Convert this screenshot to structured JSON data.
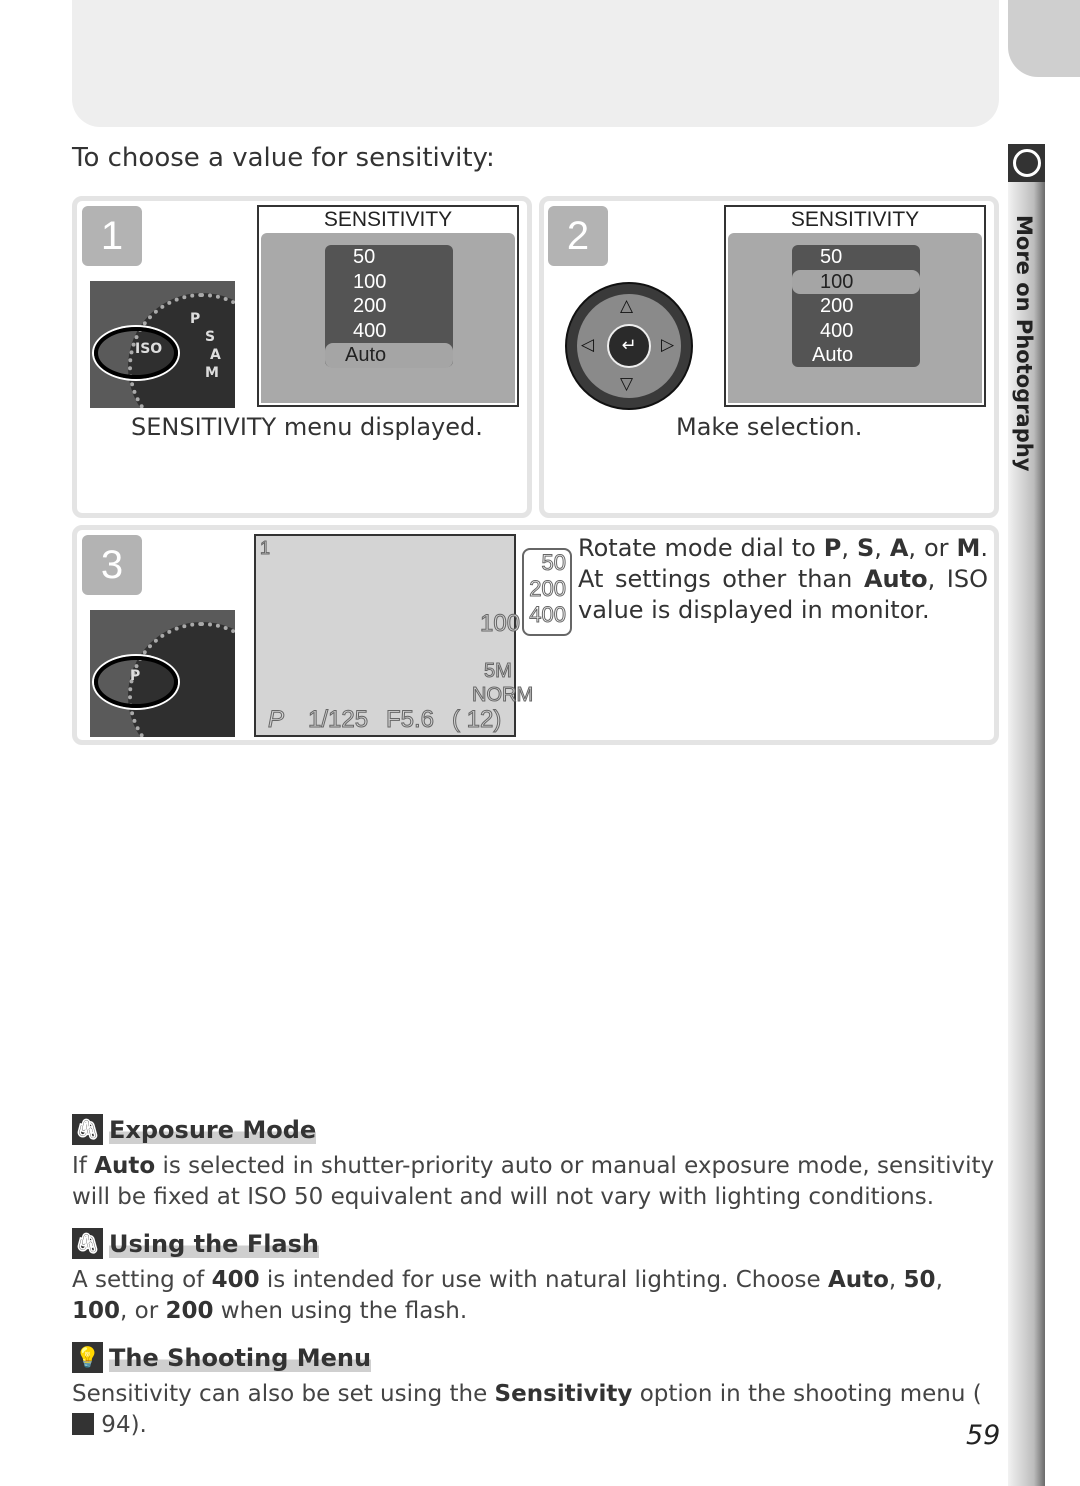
{
  "sidebar": {
    "label": "More on Photography",
    "icon": "circle-icon"
  },
  "intro": "To choose a value for sensitivity:",
  "steps": [
    {
      "number": "1",
      "menu_title": "SENSITIVITY",
      "options": [
        "50",
        "100",
        "200",
        "400",
        "Auto"
      ],
      "selected": "Auto",
      "caption": "SENSITIVITY menu displayed.",
      "dial_label": "ISO"
    },
    {
      "number": "2",
      "menu_title": "SENSITIVITY",
      "options": [
        "50",
        "100",
        "200",
        "400",
        "Auto"
      ],
      "selected": "100",
      "caption": "Make selection."
    },
    {
      "number": "3",
      "dial_label": "P",
      "monitor": {
        "frame": "1",
        "iso": "100",
        "size": "5M",
        "quality": "NORM",
        "mode": "P",
        "shutter": "1/125",
        "aperture": "F5.6",
        "remaining": "12"
      },
      "iso_values": [
        "50",
        "200",
        "400"
      ],
      "text": {
        "a": "Rotate mode dial to ",
        "p": "P",
        "c1": ", ",
        "s": "S",
        "c2": ", ",
        "am": "A",
        "c3": ", or ",
        "m": "M",
        "c4": ". At settings other than ",
        "auto": "Auto",
        "c5": ", ISO value is displayed in monitor."
      }
    }
  ],
  "notes": [
    {
      "icon": "paperclip-icon",
      "title": "Exposure Mode",
      "t1": "If ",
      "b1": "Auto",
      "t2": " is selected in shutter-priority auto or manual exposure mode, sensitivity will be fixed at ISO 50 equivalent and will not vary with lighting conditions."
    },
    {
      "icon": "paperclip-icon",
      "title": "Using the Flash",
      "t1": "A setting of ",
      "b1": "400",
      "t2": " is intended for use with natural lighting.  Choose ",
      "b2": "Auto",
      "t3": ", ",
      "b3": "50",
      "t4": ", ",
      "b4": "100",
      "t5": ", or ",
      "b5": "200",
      "t6": " when using the flash."
    },
    {
      "icon": "lightbulb-icon",
      "title": "The Shooting Menu",
      "t1": "Sensitivity can also be set using the ",
      "b1": "Sensitivity",
      "t2": " option in the shooting menu (",
      "ref_icon": "reference-icon",
      "t3": " 94)."
    }
  ],
  "page_number": "59"
}
